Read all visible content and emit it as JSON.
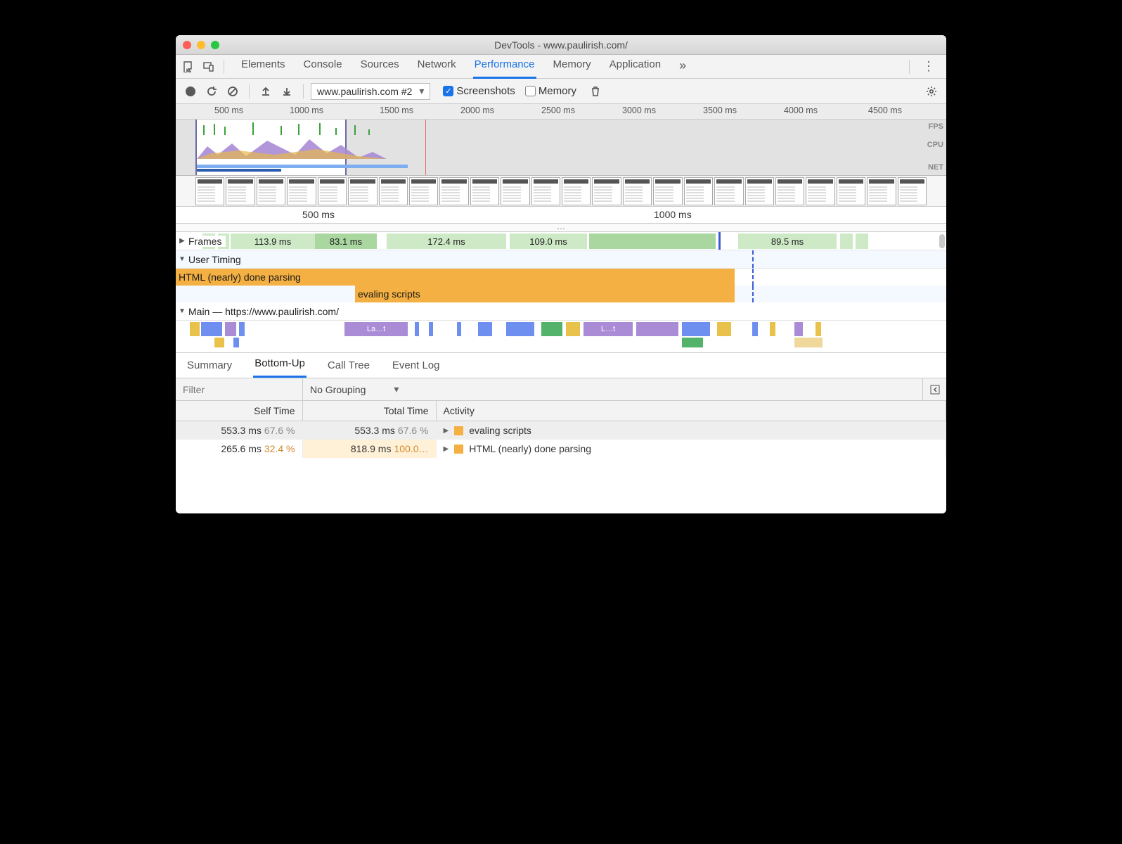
{
  "window": {
    "title": "DevTools - www.paulirish.com/"
  },
  "panelTabs": [
    "Elements",
    "Console",
    "Sources",
    "Network",
    "Performance",
    "Memory",
    "Application"
  ],
  "activePanel": "Performance",
  "toolbar": {
    "recording_select": "www.paulirish.com #2",
    "screenshots_label": "Screenshots",
    "screenshots_checked": true,
    "memory_label": "Memory",
    "memory_checked": false
  },
  "overviewTicks": [
    "500 ms",
    "1000 ms",
    "1500 ms",
    "2000 ms",
    "2500 ms",
    "3000 ms",
    "3500 ms",
    "4000 ms",
    "4500 ms"
  ],
  "overviewSideLabels": [
    "FPS",
    "CPU",
    "NET"
  ],
  "detailTicks": [
    "500 ms",
    "1000 ms"
  ],
  "framesRow": {
    "label": "Frames",
    "blocks": [
      "113.9 ms",
      "83.1 ms",
      "172.4 ms",
      "109.0 ms",
      "89.5 ms"
    ]
  },
  "userTiming": {
    "label": "User Timing",
    "bars": [
      "HTML (nearly) done parsing",
      "evaling scripts"
    ]
  },
  "mainRow": {
    "label": "Main — https://www.paulirish.com/",
    "slices": [
      "La…t",
      "L…t"
    ]
  },
  "detailTabs": [
    "Summary",
    "Bottom-Up",
    "Call Tree",
    "Event Log"
  ],
  "activeDetailTab": "Bottom-Up",
  "filter": {
    "placeholder": "Filter",
    "grouping": "No Grouping"
  },
  "table": {
    "headers": [
      "Self Time",
      "Total Time",
      "Activity"
    ],
    "rows": [
      {
        "self_ms": "553.3 ms",
        "self_pct": "67.6 %",
        "total_ms": "553.3 ms",
        "total_pct": "67.6 %",
        "activity": "evaling scripts"
      },
      {
        "self_ms": "265.6 ms",
        "self_pct": "32.4 %",
        "total_ms": "818.9 ms",
        "total_pct": "100.0…",
        "activity": "HTML (nearly) done parsing"
      }
    ]
  }
}
